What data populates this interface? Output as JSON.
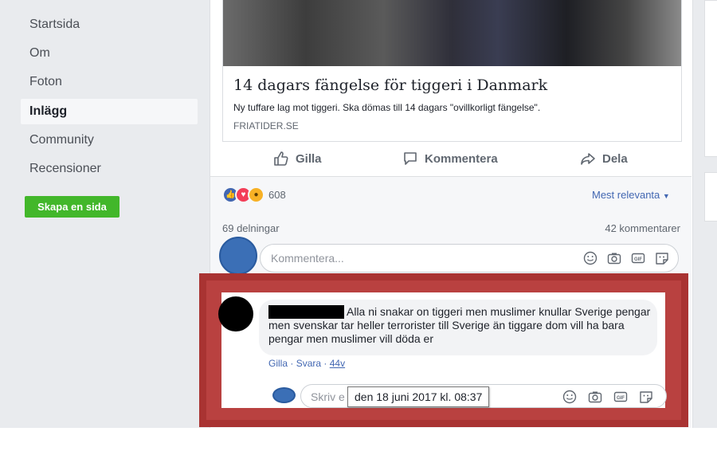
{
  "sidebar": {
    "items": [
      {
        "label": "Startsida",
        "active": false
      },
      {
        "label": "Om",
        "active": false
      },
      {
        "label": "Foton",
        "active": false
      },
      {
        "label": "Inlägg",
        "active": true
      },
      {
        "label": "Community",
        "active": false
      },
      {
        "label": "Recensioner",
        "active": false
      }
    ],
    "create_button": "Skapa en sida"
  },
  "link_preview": {
    "title": "14 dagars fängelse för tiggeri i Danmark",
    "description": "Ny tuffare lag mot tiggeri. Ska dömas till 14 dagars \"ovillkorligt fängelse\".",
    "source": "FRIATIDER.SE"
  },
  "actions": {
    "like": "Gilla",
    "comment": "Kommentera",
    "share": "Dela"
  },
  "stats": {
    "reaction_count": "608",
    "sort_label": "Mest relevanta",
    "shares": "69 delningar",
    "comments": "42 kommentarer"
  },
  "comment_box": {
    "placeholder": "Kommentera..."
  },
  "comment": {
    "text": "Alla ni snakar on tiggeri men muslimer knullar Sverige pengar men svenskar tar heller terrorister till Sverige än tiggare dom vill ha bara pengar men muslimer vill döda er",
    "like": "Gilla",
    "reply": "Svara",
    "time": "44v",
    "reply_placeholder": "Skriv e",
    "tooltip": "den 18 juni 2017 kl. 08:37"
  },
  "colors": {
    "accent": "#4267b2",
    "highlight": "#a93332",
    "create_button": "#42b72a"
  }
}
